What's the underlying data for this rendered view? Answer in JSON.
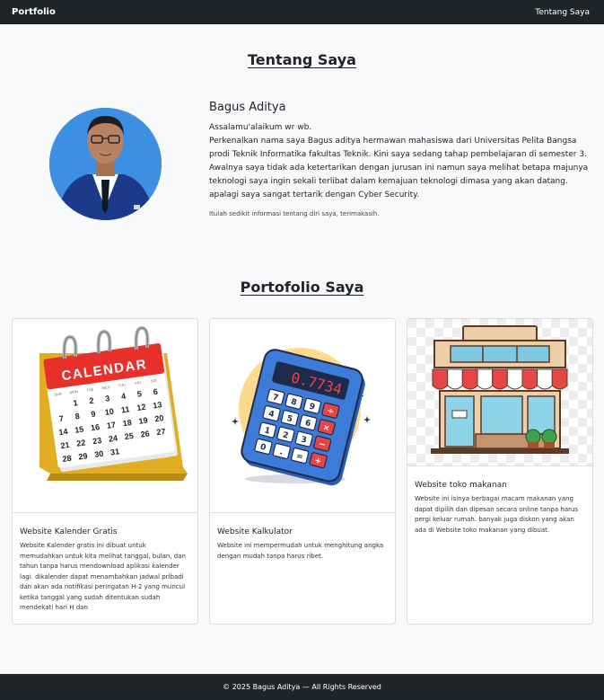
{
  "navbar": {
    "brand": "Portfolio",
    "link": "Tentang Saya"
  },
  "about": {
    "title": "Tentang Saya",
    "name": "Bagus Aditya",
    "greeting": "Assalamu'alaikum wr wb.",
    "paragraph": "Perkenalkan nama saya Bagus aditya hermawan mahasiswa dari Universitas Pelita Bangsa prodi Teknik Informatika fakultas Teknik. Kini saya sedang tahap pembelajaran di semester 3. Awalnya saya tidak ada ketertarikan dengan jurusan ini namun saya melihat betapa majunya teknologi saya ingin sekali terlibat dalam kemajuan teknologi dimasa yang akan datang. apalagi saya sangat tertarik dengan Cyber Security.",
    "closing": "Itulah sedikit informasi tentang diri saya, terimakasih."
  },
  "portfolio": {
    "title": "Portofolio Saya",
    "cards": [
      {
        "title": "Website Kalender Gratis",
        "text": "Website Kalender gratis ini dibuat untuk memudahkan untuk kita melihat tanggal, bulan, dan tahun tanpa harus mendownload aplikasi kalender lagi. dikalender dapat menambahkan jadwal pribadi dan akan ada notifikasi peringatan H-2 yang muncul ketika tanggal yang sudah ditentukan sudah mendekati hari H dan",
        "icon": "calendar-icon",
        "image_text": "CALENDAR",
        "days": [
          "SUN",
          "MON",
          "TUE",
          "WED",
          "THU",
          "FRI",
          "SAT"
        ],
        "dates": [
          "",
          "1",
          "2",
          "3",
          "4",
          "5",
          "6",
          "7",
          "8",
          "9",
          "10",
          "11",
          "12",
          "13",
          "14",
          "15",
          "16",
          "17",
          "18",
          "19",
          "20",
          "21",
          "22",
          "23",
          "24",
          "25",
          "26",
          "27",
          "28",
          "29",
          "30",
          "31"
        ]
      },
      {
        "title": "Website Kalkulator",
        "text": "Website ini mempermudah untuk menghitung angka dengan mudah tanpa harus ribet.",
        "icon": "calculator-icon",
        "display": "0.7734",
        "keys": [
          "7",
          "8",
          "9",
          "÷",
          "4",
          "5",
          "6",
          "×",
          "1",
          "2",
          "3",
          "−",
          "0",
          ".",
          "=",
          "+"
        ]
      },
      {
        "title": "Website toko makanan",
        "text": "Website ini isinya berbagai macam makanan yang dapat dipilih dan dipesan secara online tanpa harus pergi keluar rumah. banyak juga diskon yang akan ada di Website toko makanan yang dibuat.",
        "icon": "store-icon"
      }
    ]
  },
  "footer": {
    "text": "© 2025 Bagus Aditya — All Rights Reserved"
  },
  "colors": {
    "nav_bg": "#212529",
    "page_bg": "#f8f9fa",
    "card_border": "#dcdcdc",
    "calendar_red": "#e8302a",
    "calendar_yellow": "#f2c230",
    "calculator_blue": "#3d7bd9",
    "awning_red": "#e84545"
  }
}
